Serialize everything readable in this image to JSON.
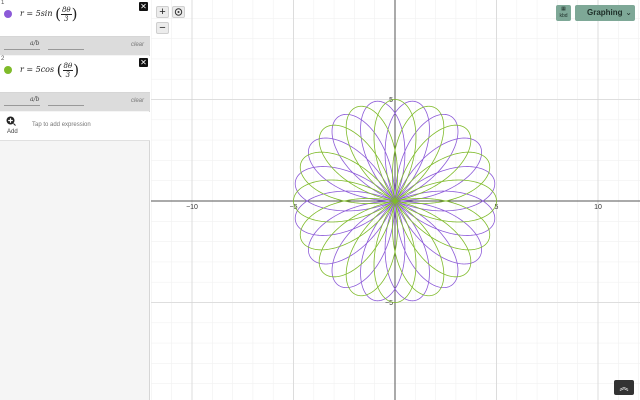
{
  "expressions": [
    {
      "index": "1",
      "prefix": "r = 5",
      "func": "sin",
      "numerator": "8θ",
      "denominator": "3",
      "color": "#8c5ad8"
    },
    {
      "index": "2",
      "prefix": "r = 5",
      "func": "cos",
      "numerator": "8θ",
      "denominator": "3",
      "color": "#7fbb2a"
    }
  ],
  "slider": {
    "label": "a/b",
    "clear_label": "clear"
  },
  "add": {
    "label": "Add",
    "hint": "Tap to add expression"
  },
  "toolbar": {
    "zoom_in": "+",
    "zoom_out": "−",
    "mode_label": "Graphing",
    "keypad_label": "kbd"
  },
  "axes": {
    "x_ticks": [
      "−10",
      "−5",
      "5",
      "10"
    ],
    "y_ticks": [
      "5",
      "−5"
    ],
    "x_range": [
      -12,
      12
    ],
    "y_range": [
      -9.8,
      9.8
    ]
  },
  "curves": [
    {
      "type": "polar",
      "fn": "sin",
      "amplitude": 5,
      "k_num": 8,
      "k_den": 3,
      "color": "#8c5ad8"
    },
    {
      "type": "polar",
      "fn": "cos",
      "amplitude": 5,
      "k_num": 8,
      "k_den": 3,
      "color": "#7fbb2a"
    }
  ]
}
